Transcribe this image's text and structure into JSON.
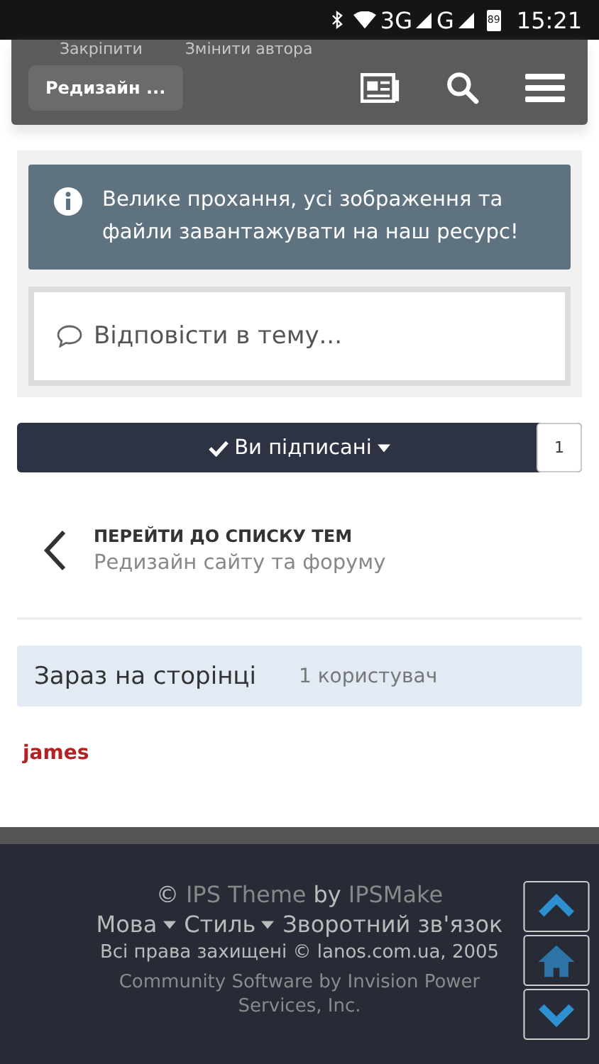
{
  "status_bar": {
    "time": "15:21",
    "battery": "89",
    "network_1": "3G",
    "network_2": "G"
  },
  "top_actions": [
    "Закріпити",
    "Змінити автора"
  ],
  "header": {
    "breadcrumb": "Редизайн ..."
  },
  "notice": {
    "text": "Велике прохання, усі зображення та файли завантажувати на наш ресурс!"
  },
  "reply": {
    "placeholder": "Відповісти в тему..."
  },
  "follow": {
    "label": "Ви підписані",
    "count": "1"
  },
  "back_link": {
    "title": "ПЕРЕЙТИ ДО СПИСКУ ТЕМ",
    "subtitle": "Редизайн сайту та форуму"
  },
  "online": {
    "title": "Зараз на сторінці",
    "count": "1 користувач",
    "users": [
      "james"
    ]
  },
  "footer": {
    "copyright_mark": "©",
    "theme": "IPS Theme",
    "by": "by",
    "maker": "IPSMake",
    "links": [
      {
        "label": "Мова",
        "dropdown": true
      },
      {
        "label": "Стиль",
        "dropdown": true
      },
      {
        "label": "Зворотний зв'язок",
        "dropdown": false
      }
    ],
    "rights": "Всі права захищені © lanos.com.ua, 2005",
    "software": "Community Software by Invision Power Services, Inc."
  }
}
